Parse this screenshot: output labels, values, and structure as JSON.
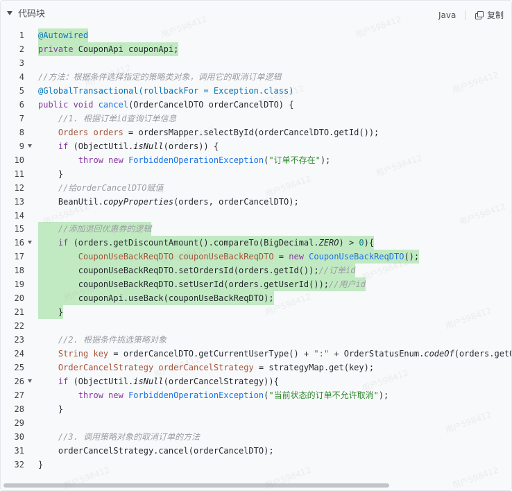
{
  "header": {
    "title": "代码块",
    "language": "Java",
    "copy_label": "复制"
  },
  "watermark": "用户598412",
  "lines": [
    {
      "n": "1",
      "fold": false,
      "hl": true,
      "tokens": [
        [
          "t-ann",
          "@Autowired"
        ]
      ]
    },
    {
      "n": "2",
      "fold": false,
      "hl": true,
      "tokens": [
        [
          "t-kw",
          "private "
        ],
        [
          "t-pl",
          "CouponApi couponApi;"
        ]
      ]
    },
    {
      "n": "3",
      "fold": false,
      "hl": false,
      "tokens": []
    },
    {
      "n": "4",
      "fold": false,
      "hl": false,
      "tokens": [
        [
          "t-cm",
          "//方法：根据条件选择指定的策略类对象，调用它的取消订单逻辑"
        ]
      ]
    },
    {
      "n": "5",
      "fold": false,
      "hl": false,
      "tokens": [
        [
          "t-ann",
          "@GlobalTransactional(rollbackFor = Exception.class)"
        ]
      ]
    },
    {
      "n": "6",
      "fold": false,
      "hl": false,
      "tokens": [
        [
          "t-kw",
          "public "
        ],
        [
          "t-kw",
          "void "
        ],
        [
          "t-fn",
          "cancel"
        ],
        [
          "t-pl",
          "(OrderCancelDTO orderCancelDTO) {"
        ]
      ]
    },
    {
      "n": "7",
      "fold": false,
      "hl": false,
      "tokens": [
        [
          "t-pl",
          "    "
        ],
        [
          "t-cm",
          "//1. 根据订单id查询订单信息"
        ]
      ]
    },
    {
      "n": "8",
      "fold": false,
      "hl": false,
      "tokens": [
        [
          "t-pl",
          "    "
        ],
        [
          "t-ty",
          "Orders orders"
        ],
        [
          "t-pl",
          " = ordersMapper.selectById(orderCancelDTO.getId());"
        ]
      ]
    },
    {
      "n": "9",
      "fold": true,
      "hl": false,
      "tokens": [
        [
          "t-pl",
          "    "
        ],
        [
          "t-kw",
          "if"
        ],
        [
          "t-pl",
          " (ObjectUtil."
        ],
        [
          "t-it",
          "isNull"
        ],
        [
          "t-pl",
          "(orders)) {"
        ]
      ]
    },
    {
      "n": "10",
      "fold": false,
      "hl": false,
      "tokens": [
        [
          "t-pl",
          "        "
        ],
        [
          "t-kw",
          "throw "
        ],
        [
          "t-kw",
          "new "
        ],
        [
          "t-cls",
          "ForbiddenOperationException"
        ],
        [
          "t-pl",
          "("
        ],
        [
          "t-str",
          "\"订单不存在\""
        ],
        [
          "t-pl",
          ");"
        ]
      ]
    },
    {
      "n": "11",
      "fold": false,
      "hl": false,
      "tokens": [
        [
          "t-pl",
          "    }"
        ]
      ]
    },
    {
      "n": "12",
      "fold": false,
      "hl": false,
      "tokens": [
        [
          "t-pl",
          "    "
        ],
        [
          "t-cm",
          "//给orderCancelDTO赋值"
        ]
      ]
    },
    {
      "n": "13",
      "fold": false,
      "hl": false,
      "tokens": [
        [
          "t-pl",
          "    BeanUtil."
        ],
        [
          "t-it",
          "copyProperties"
        ],
        [
          "t-pl",
          "(orders, orderCancelDTO);"
        ]
      ]
    },
    {
      "n": "14",
      "fold": false,
      "hl": false,
      "tokens": []
    },
    {
      "n": "15",
      "fold": false,
      "hl": true,
      "tokens": [
        [
          "t-pl",
          "    "
        ],
        [
          "t-cm",
          "//添加退回优惠券的逻辑"
        ]
      ]
    },
    {
      "n": "16",
      "fold": true,
      "hl": true,
      "tokens": [
        [
          "t-pl",
          "    "
        ],
        [
          "t-kw",
          "if"
        ],
        [
          "t-pl",
          " (orders.getDiscountAmount().compareTo(BigDecimal."
        ],
        [
          "t-it",
          "ZERO"
        ],
        [
          "t-pl",
          ") > "
        ],
        [
          "t-num",
          "0"
        ],
        [
          "t-pl",
          "){"
        ]
      ]
    },
    {
      "n": "17",
      "fold": false,
      "hl": true,
      "tokens": [
        [
          "t-pl",
          "        "
        ],
        [
          "t-ty",
          "CouponUseBackReqDTO couponUseBackReqDTO"
        ],
        [
          "t-pl",
          " = "
        ],
        [
          "t-kw",
          "new "
        ],
        [
          "t-cls",
          "CouponUseBackReqDTO"
        ],
        [
          "t-pl",
          "();"
        ]
      ]
    },
    {
      "n": "18",
      "fold": false,
      "hl": true,
      "tokens": [
        [
          "t-pl",
          "        couponUseBackReqDTO.setOrdersId(orders.getId());"
        ],
        [
          "t-cm",
          "//订单id"
        ]
      ]
    },
    {
      "n": "19",
      "fold": false,
      "hl": true,
      "tokens": [
        [
          "t-pl",
          "        couponUseBackReqDTO.setUserId(orders.getUserId());"
        ],
        [
          "t-cm",
          "//用户id"
        ]
      ]
    },
    {
      "n": "20",
      "fold": false,
      "hl": true,
      "tokens": [
        [
          "t-pl",
          "        couponApi.useBack(couponUseBackReqDTO);"
        ]
      ]
    },
    {
      "n": "21",
      "fold": false,
      "hl": true,
      "tokens": [
        [
          "t-pl",
          "    }"
        ]
      ]
    },
    {
      "n": "22",
      "fold": false,
      "hl": false,
      "tokens": []
    },
    {
      "n": "23",
      "fold": false,
      "hl": false,
      "tokens": [
        [
          "t-pl",
          "    "
        ],
        [
          "t-cm",
          "//2. 根据条件挑选策略对象"
        ]
      ]
    },
    {
      "n": "24",
      "fold": false,
      "hl": false,
      "tokens": [
        [
          "t-pl",
          "    "
        ],
        [
          "t-ty",
          "String key"
        ],
        [
          "t-pl",
          " = orderCancelDTO.getCurrentUserType() + "
        ],
        [
          "t-str",
          "\":\""
        ],
        [
          "t-pl",
          " + OrderStatusEnum."
        ],
        [
          "t-it",
          "codeOf"
        ],
        [
          "t-pl",
          "(orders.getOrdersStatus()).getStatus();"
        ]
      ]
    },
    {
      "n": "25",
      "fold": false,
      "hl": false,
      "tokens": [
        [
          "t-pl",
          "    "
        ],
        [
          "t-ty",
          "OrderCancelStrategy orderCancelStrategy"
        ],
        [
          "t-pl",
          " = strategyMap.get(key);"
        ]
      ]
    },
    {
      "n": "26",
      "fold": true,
      "hl": false,
      "tokens": [
        [
          "t-pl",
          "    "
        ],
        [
          "t-kw",
          "if"
        ],
        [
          "t-pl",
          " (ObjectUtil."
        ],
        [
          "t-it",
          "isNull"
        ],
        [
          "t-pl",
          "(orderCancelStrategy)){"
        ]
      ]
    },
    {
      "n": "27",
      "fold": false,
      "hl": false,
      "tokens": [
        [
          "t-pl",
          "        "
        ],
        [
          "t-kw",
          "throw "
        ],
        [
          "t-kw",
          "new "
        ],
        [
          "t-cls",
          "ForbiddenOperationException"
        ],
        [
          "t-pl",
          "("
        ],
        [
          "t-str",
          "\"当前状态的订单不允许取消\""
        ],
        [
          "t-pl",
          ");"
        ]
      ]
    },
    {
      "n": "28",
      "fold": false,
      "hl": false,
      "tokens": [
        [
          "t-pl",
          "    }"
        ]
      ]
    },
    {
      "n": "29",
      "fold": false,
      "hl": false,
      "tokens": []
    },
    {
      "n": "30",
      "fold": false,
      "hl": false,
      "tokens": [
        [
          "t-pl",
          "    "
        ],
        [
          "t-cm",
          "//3. 调用策略对象的取消订单的方法"
        ]
      ]
    },
    {
      "n": "31",
      "fold": false,
      "hl": false,
      "tokens": [
        [
          "t-pl",
          "    orderCancelStrategy.cancel(orderCancelDTO);"
        ]
      ]
    },
    {
      "n": "32",
      "fold": false,
      "hl": false,
      "tokens": [
        [
          "t-pl",
          "}"
        ]
      ]
    }
  ]
}
